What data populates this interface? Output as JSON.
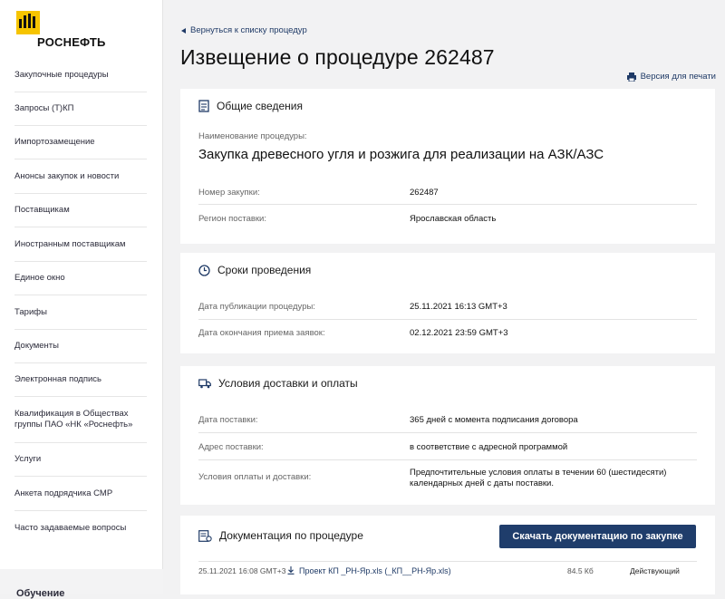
{
  "brand": {
    "name": "РОСНЕФТЬ"
  },
  "sidebar": {
    "items": [
      {
        "label": "Закупочные процедуры"
      },
      {
        "label": "Запросы (Т)КП"
      },
      {
        "label": "Импортозамещение"
      },
      {
        "label": "Анонсы закупок и новости"
      },
      {
        "label": "Поставщикам"
      },
      {
        "label": "Иностранным поставщикам"
      },
      {
        "label": "Единое окно"
      },
      {
        "label": "Тарифы"
      },
      {
        "label": "Документы"
      },
      {
        "label": "Электронная подпись"
      },
      {
        "label": "Квалификация в Обществах группы ПАО «НК «Роснефть»"
      },
      {
        "label": "Услуги"
      },
      {
        "label": "Анкета подрядчика СМР"
      },
      {
        "label": "Часто задаваемые вопросы"
      }
    ],
    "bottom_label": "Обучение"
  },
  "header": {
    "back_label": "Вернуться к списку процедур",
    "title": "Извещение о процедуре 262487",
    "print_label": "Версия для печати"
  },
  "general": {
    "title": "Общие сведения",
    "name_label": "Наименование процедуры:",
    "name_value": "Закупка древесного угля и розжига для реализации на АЗК/АЗС",
    "rows": [
      {
        "label": "Номер закупки:",
        "value": "262487"
      },
      {
        "label": "Регион поставки:",
        "value": "Ярославская область"
      }
    ]
  },
  "terms": {
    "title": "Сроки проведения",
    "rows": [
      {
        "label": "Дата публикации процедуры:",
        "value": "25.11.2021 16:13 GMT+3"
      },
      {
        "label": "Дата окончания приема заявок:",
        "value": "02.12.2021 23:59 GMT+3"
      }
    ]
  },
  "delivery": {
    "title": "Условия доставки и оплаты",
    "rows": [
      {
        "label": "Дата поставки:",
        "value": "365 дней с момента подписания договора"
      },
      {
        "label": "Адрес поставки:",
        "value": "в соответствие с адресной программой"
      },
      {
        "label": "Условия оплаты и доставки:",
        "value": "Предпочтительные условия оплаты в течении 60 (шестидесяти) календарных дней с даты поставки."
      }
    ]
  },
  "docs": {
    "title": "Документация по процедуре",
    "download_label": "Скачать документацию по закупке",
    "files": [
      {
        "date": "25.11.2021 16:08 GMT+3",
        "name": "Проект КП _РН-Яр.xls (_КП__РН-Яр.xls)",
        "size": "84.5 Кб",
        "status": "Действующий"
      }
    ]
  },
  "colors": {
    "accent": "#1f3d6b",
    "brand_yellow": "#f6c400",
    "background": "#f2f2f3"
  }
}
